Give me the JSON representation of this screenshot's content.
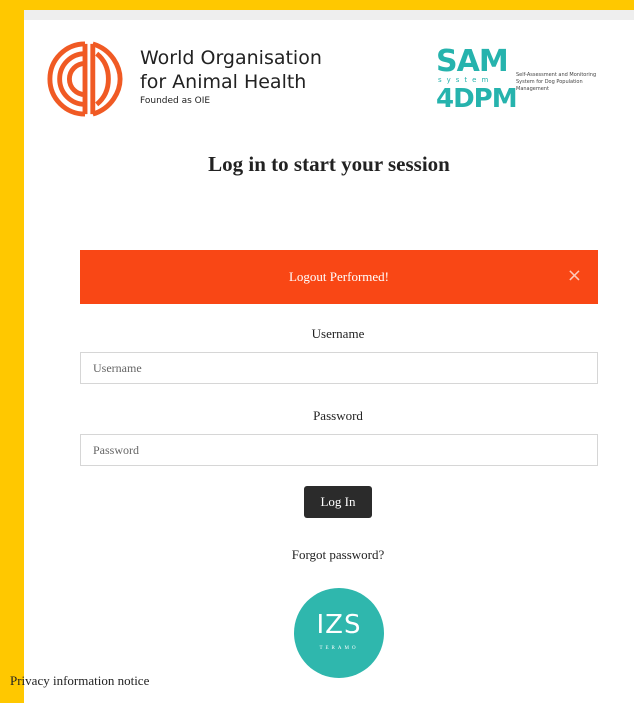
{
  "woah": {
    "line1": "World Organisation",
    "line2": "for Animal Health",
    "line3": "Founded as OIE"
  },
  "sam": {
    "title": "SAM",
    "system": "system",
    "name": "4DPM",
    "description": "Self-Assessment and Monitoring System for Dog Population Management"
  },
  "page_title": "Log in to start your session",
  "alert": {
    "message": "Logout Performed!",
    "close": "×",
    "color": "#f94715"
  },
  "form": {
    "username_label": "Username",
    "username_placeholder": "Username",
    "username_value": "",
    "password_label": "Password",
    "password_placeholder": "Password",
    "password_value": "",
    "login_button": "Log In",
    "forgot_link": "Forgot password?"
  },
  "izs": {
    "text": "IZS",
    "sub": "TERAMO"
  },
  "privacy_link": "Privacy information notice",
  "colors": {
    "background": "#ffc800",
    "accent_teal": "#26b3ad",
    "woah_orange": "#f05a24"
  }
}
